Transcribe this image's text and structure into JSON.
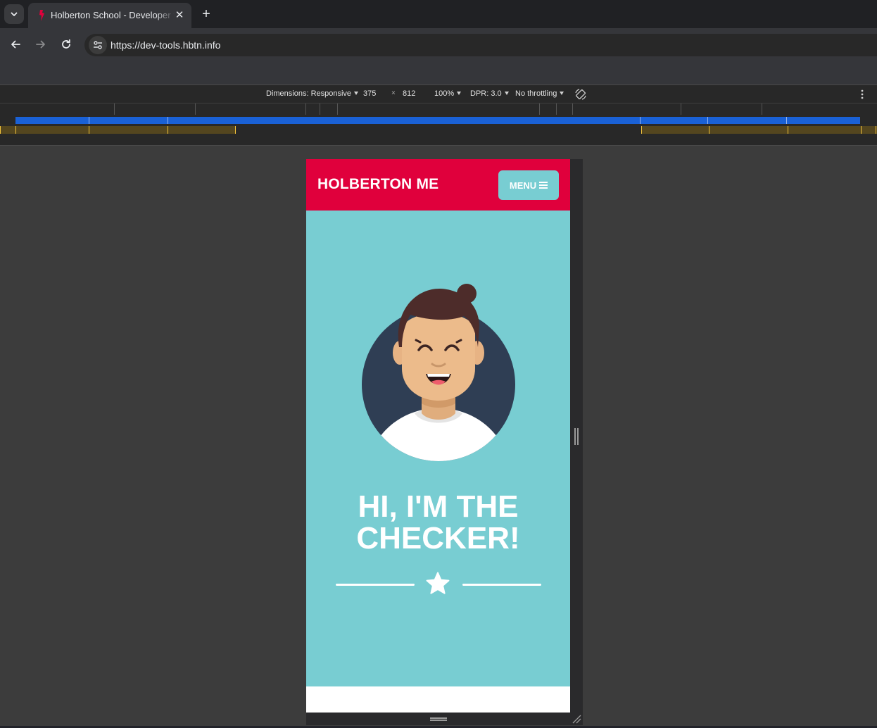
{
  "browser": {
    "tab": {
      "title": "Holberton School - Developer tools"
    },
    "url": "https://dev-tools.hbtn.info"
  },
  "devtools": {
    "dimensions_label": "Dimensions: Responsive",
    "width": "375",
    "times": "×",
    "height": "812",
    "zoom": "100%",
    "dpr": "DPR: 3.0",
    "throttling": "No throttling"
  },
  "page": {
    "header": {
      "logo": "HOLBERTON ME",
      "menu_label": "MENU"
    },
    "hero": {
      "title_line1": "HI, I'M THE",
      "title_line2": "CHECKER!"
    },
    "colors": {
      "header_red": "#e0003c",
      "hero_teal": "#78cdd2",
      "avatar_circle": "#2f3e54"
    }
  },
  "icons": [
    "tab-search-icon",
    "holberton-favicon-icon",
    "close-icon",
    "new-tab-icon",
    "back-icon",
    "forward-icon",
    "reload-icon",
    "site-info-icon",
    "rotate-icon",
    "more-options-icon",
    "hamburger-icon",
    "star-icon"
  ]
}
